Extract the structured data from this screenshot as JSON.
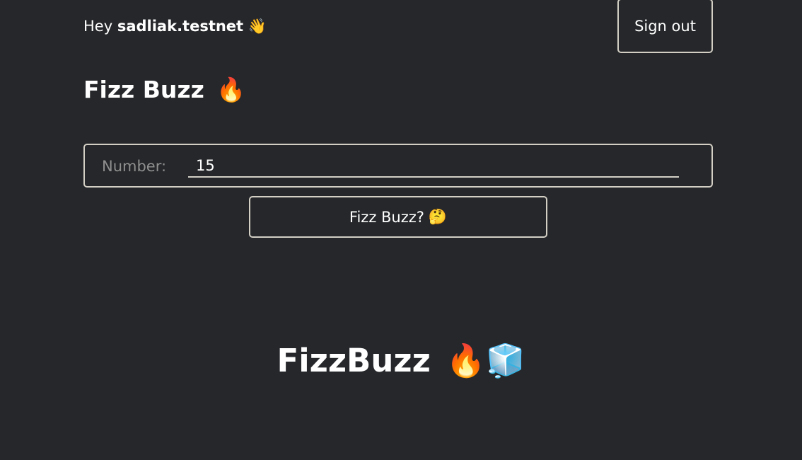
{
  "header": {
    "greeting_prefix": "Hey",
    "username": "sadliak.testnet",
    "greeting_emoji": "👋",
    "sign_out_label": "Sign out"
  },
  "main": {
    "title": "Fizz Buzz",
    "title_emoji": "🔥",
    "form": {
      "number_label": "Number:",
      "number_value": "15"
    },
    "submit_label": "Fizz Buzz?",
    "submit_emoji": "🤔",
    "result_text": "FizzBuzz",
    "result_emoji": "🔥🧊"
  },
  "colors": {
    "background": "#25272a",
    "border": "#d3cfc5",
    "text": "#ffffff",
    "label": "#8f8f8f"
  },
  "icons": {
    "greeting": "waving-hand-emoji",
    "title": "fire-emoji",
    "submit": "thinking-face-emoji",
    "result": [
      "fire-emoji",
      "ice-cube-emoji"
    ]
  }
}
